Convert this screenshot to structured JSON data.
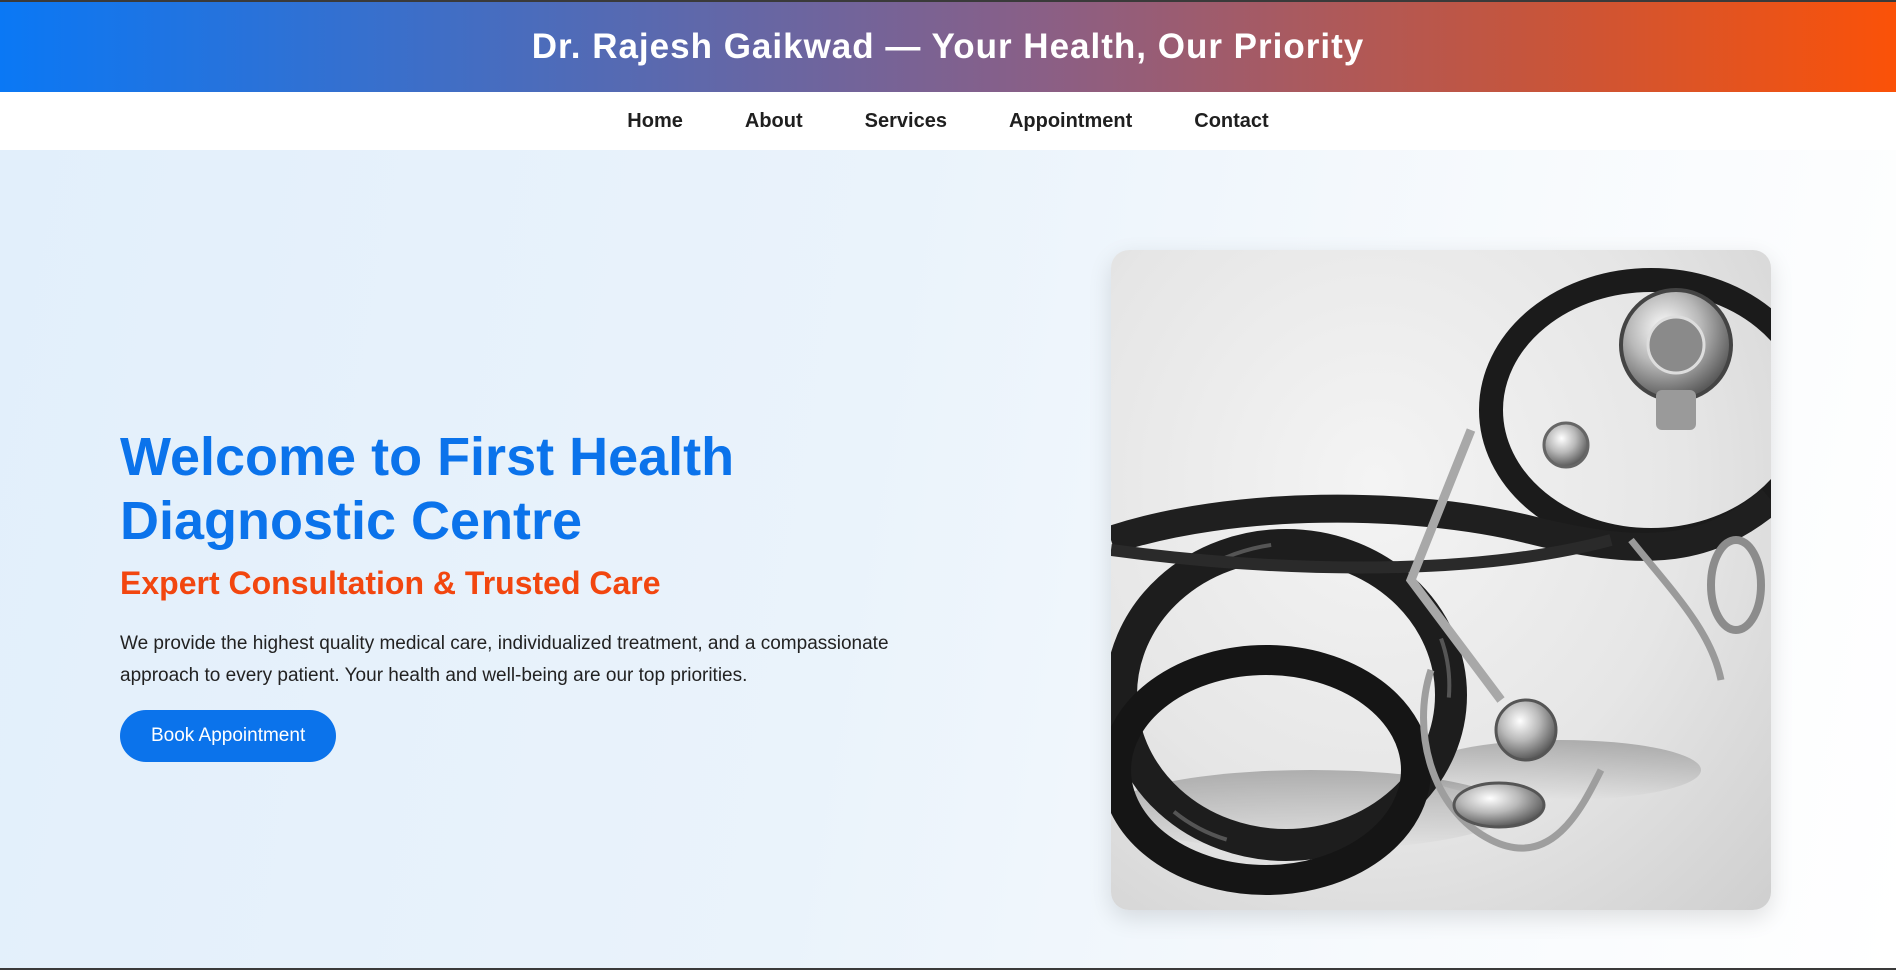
{
  "header": {
    "banner_title": "Dr. Rajesh Gaikwad — Your Health, Our Priority"
  },
  "nav": {
    "items": [
      {
        "label": "Home"
      },
      {
        "label": "About"
      },
      {
        "label": "Services"
      },
      {
        "label": "Appointment"
      },
      {
        "label": "Contact"
      }
    ]
  },
  "hero": {
    "title": "Welcome to First Health Diagnostic Centre",
    "subtitle": "Expert Consultation & Trusted Care",
    "description": "We provide the highest quality medical care, individualized treatment, and a compassionate approach to every patient. Your health and well-being are our top priorities.",
    "cta_label": "Book Appointment",
    "image_icon": "stethoscope-photo"
  },
  "colors": {
    "accent_blue": "#0b73eb",
    "accent_orange": "#f2460f",
    "banner_start": "#0a78f5",
    "banner_end": "#fb5208"
  }
}
